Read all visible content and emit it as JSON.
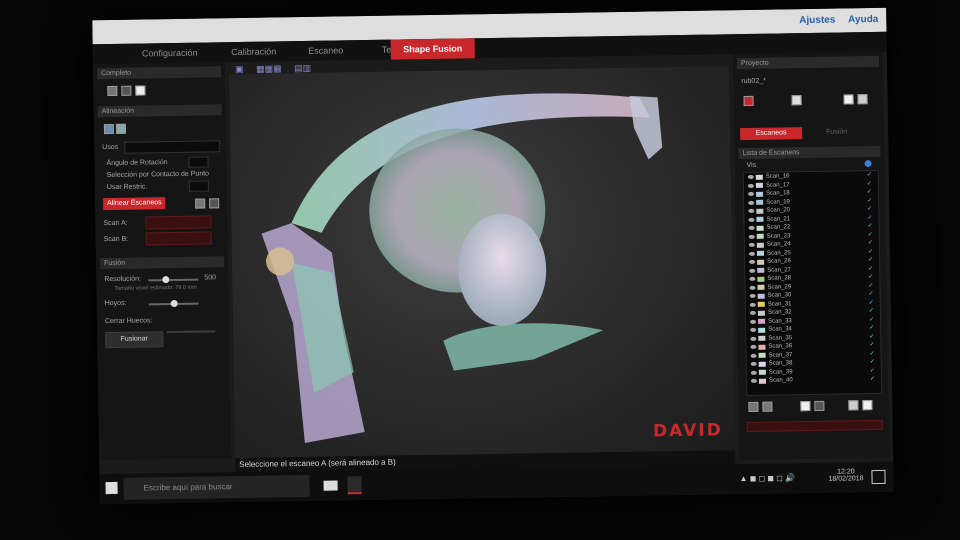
{
  "titlebar": {
    "help_items": [
      "Ajustes",
      "Ayuda"
    ]
  },
  "tabs": [
    {
      "label": "Configuración",
      "active": false
    },
    {
      "label": "Calibración",
      "active": false
    },
    {
      "label": "Escaneo",
      "active": false
    },
    {
      "label": "Texturizado",
      "active": false
    },
    {
      "label": "Shape Fusion",
      "active": true
    }
  ],
  "left": {
    "section_complete": "Completo",
    "section_align": "Alineación",
    "uses_label": "Usos",
    "option_rotation_axis": "Ángulo de Rotación",
    "option_contact": "Selección por Contacto de Punto",
    "option_free": "Usar Restric.",
    "align_button": "Alinear Escaneos",
    "scan_a_label": "Scan A:",
    "scan_b_label": "Scan B:",
    "section_fusion": "Fusión",
    "resolution_label": "Resolución:",
    "resolution_value": "500",
    "resolution_hint": "Tamaño vóxel estimado: 79.0 mm",
    "holes_label": "Hoyos:",
    "close_holes_label": "Cerrar Huecos:",
    "fuse_button": "Fusionar"
  },
  "viewport": {
    "logo": "DAVID",
    "status_text": "Seleccione el escaneo A (será alineado a B)"
  },
  "right": {
    "project_title": "Proyecto",
    "project_name": "rub02_*",
    "tab_scans": "Escaneos",
    "tab_other": "Fusión",
    "list_title": "Lista de Escaneos",
    "list_header": "Vis",
    "scans": [
      {
        "name": "Scan_16",
        "color": "#d8d8d8"
      },
      {
        "name": "Scan_17",
        "color": "#cfd6de"
      },
      {
        "name": "Scan_18",
        "color": "#b9c7d6"
      },
      {
        "name": "Scan_19",
        "color": "#aac5d8"
      },
      {
        "name": "Scan_20",
        "color": "#c8c8c8"
      },
      {
        "name": "Scan_21",
        "color": "#b0d0e0"
      },
      {
        "name": "Scan_22",
        "color": "#d0e0d0"
      },
      {
        "name": "Scan_23",
        "color": "#c0d8c8"
      },
      {
        "name": "Scan_24",
        "color": "#cccccc"
      },
      {
        "name": "Scan_25",
        "color": "#b8d0d8"
      },
      {
        "name": "Scan_26",
        "color": "#d8c8b8"
      },
      {
        "name": "Scan_27",
        "color": "#c8b8d8"
      },
      {
        "name": "Scan_28",
        "color": "#9bd37a"
      },
      {
        "name": "Scan_29",
        "color": "#d0d0a8"
      },
      {
        "name": "Scan_30",
        "color": "#c0c0e0"
      },
      {
        "name": "Scan_31",
        "color": "#e0d070"
      },
      {
        "name": "Scan_32",
        "color": "#c8c8c8"
      },
      {
        "name": "Scan_33",
        "color": "#d9a0c0"
      },
      {
        "name": "Scan_34",
        "color": "#b0e0e0"
      },
      {
        "name": "Scan_35",
        "color": "#d0d0d0"
      },
      {
        "name": "Scan_36",
        "color": "#e0b0b0"
      },
      {
        "name": "Scan_37",
        "color": "#c0e0c0"
      },
      {
        "name": "Scan_38",
        "color": "#d8d8e8"
      },
      {
        "name": "Scan_39",
        "color": "#c8d8d8"
      },
      {
        "name": "Scan_40",
        "color": "#e0c8d8"
      }
    ]
  },
  "taskbar": {
    "search_placeholder": "Escribe aquí para buscar",
    "time": "12:20",
    "date": "18/02/2018"
  },
  "colors": {
    "accent": "#c8282b",
    "panel": "#151515",
    "viewport": "#2e2e2e"
  }
}
